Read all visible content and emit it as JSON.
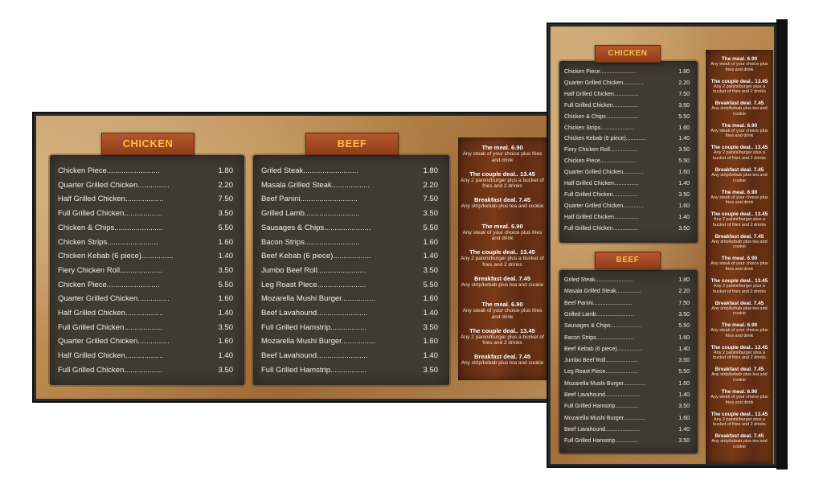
{
  "chicken_title": "CHICKEN",
  "beef_title": "BEEF",
  "chicken": [
    {
      "name": "Chicken Piece",
      "price": "1.80"
    },
    {
      "name": "Quarter Grilled Chicken",
      "price": "2.20"
    },
    {
      "name": "Half Grilled Chicken",
      "price": "7.50"
    },
    {
      "name": "Full Grilled Chicken",
      "price": "3.50"
    },
    {
      "name": "Chicken & Chips",
      "price": "5.50"
    },
    {
      "name": "Chicken Strips",
      "price": "1.60"
    },
    {
      "name": "Chicken Kebab (6 piece)",
      "price": "1.40"
    },
    {
      "name": "Fiery Chicken Roll",
      "price": "3.50"
    },
    {
      "name": "Chicken Piece",
      "price": "5.50"
    },
    {
      "name": "Quarter Grilled Chicken",
      "price": "1.60"
    },
    {
      "name": "Half Grilled Chicken",
      "price": "1.40"
    },
    {
      "name": "Full Grilled Chicken",
      "price": "3.50"
    },
    {
      "name": "Quarter Grilled Chicken",
      "price": "1.60"
    },
    {
      "name": "Half Grilled Chicken",
      "price": "1.40"
    },
    {
      "name": "Full Grilled Chicken",
      "price": "3.50"
    }
  ],
  "beef": [
    {
      "name": "Griled Steak",
      "price": "1.80"
    },
    {
      "name": "Masala Grilled Steak",
      "price": "2.20"
    },
    {
      "name": "Beef Panini",
      "price": "7.50"
    },
    {
      "name": "Grilled Lamb",
      "price": "3.50"
    },
    {
      "name": "Sausages & Chips",
      "price": "5.50"
    },
    {
      "name": "Bacon Strips",
      "price": "1.60"
    },
    {
      "name": "Beef Kebab (6 piece)",
      "price": "1.40"
    },
    {
      "name": "Jumbo Beef Roll",
      "price": "3.50"
    },
    {
      "name": "Leg Roast Piece",
      "price": "5.50"
    },
    {
      "name": "Mozarella Mushi Burger",
      "price": "1.60"
    },
    {
      "name": "Beef Lavahound",
      "price": "1.40"
    },
    {
      "name": "Full Grilled Hamstrip",
      "price": "3.50"
    },
    {
      "name": "Mozarella Mushi Burger",
      "price": "1.60"
    },
    {
      "name": "Beef Lavahound",
      "price": "1.40"
    },
    {
      "name": "Full Grilled Hamstrip",
      "price": "3.50"
    }
  ],
  "deals": [
    {
      "title": "The meal. 6.90",
      "desc": "Any steak of your choice plus fries and drink"
    },
    {
      "title": "The couple deal.. 13.45",
      "desc": "Any 2 panini/burger plus a bucket of fries and 2 drinks"
    },
    {
      "title": "Breakfast deal. 7.45",
      "desc": "Any strip/kebab plus tea and cookie"
    }
  ],
  "colors": {
    "badge_text": "#f5c23a",
    "panel": "#403a33",
    "deal_bg": "#6e3416"
  }
}
